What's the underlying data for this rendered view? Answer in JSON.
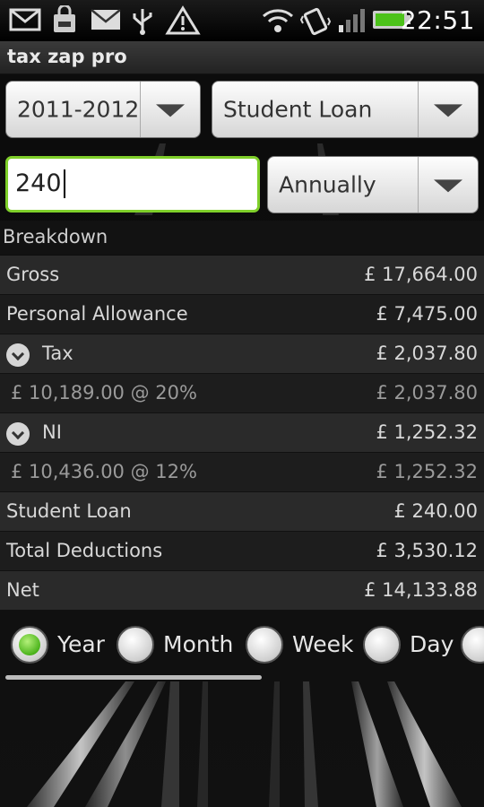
{
  "statusbar": {
    "icons": [
      "gmail-icon",
      "bag-icon",
      "mail-icon",
      "usb-icon",
      "alert-icon",
      "wifi-icon",
      "vibrate-icon",
      "signal-icon",
      "battery-icon"
    ],
    "time": "22:51"
  },
  "app": {
    "title": "tax zap pro"
  },
  "controls": {
    "year_select": "2011-2012",
    "deduction_select": "Student Loan",
    "amount_value": "240",
    "period_select": "Annually"
  },
  "breakdown": {
    "header": "Breakdown",
    "rows": [
      {
        "label": "Gross",
        "amount": "£ 17,664.00"
      },
      {
        "label": "Personal Allowance",
        "amount": "£ 7,475.00"
      },
      {
        "label": "Tax",
        "amount": "£ 2,037.80"
      },
      {
        "label": "£ 10,189.00 @ 20%",
        "amount": "£ 2,037.80"
      },
      {
        "label": "NI",
        "amount": "£ 1,252.32"
      },
      {
        "label": "£ 10,436.00 @ 12%",
        "amount": "£ 1,252.32"
      },
      {
        "label": "Student Loan",
        "amount": "£ 240.00"
      },
      {
        "label": "Total Deductions",
        "amount": "£ 3,530.12"
      },
      {
        "label": "Net",
        "amount": "£ 14,133.88"
      }
    ]
  },
  "period_radios": [
    {
      "label": "Year",
      "selected": true
    },
    {
      "label": "Month",
      "selected": false
    },
    {
      "label": "Week",
      "selected": false
    },
    {
      "label": "Day",
      "selected": false
    }
  ],
  "colors": {
    "accent": "#7fcf2a",
    "radio_selected": "#4cb41c"
  }
}
